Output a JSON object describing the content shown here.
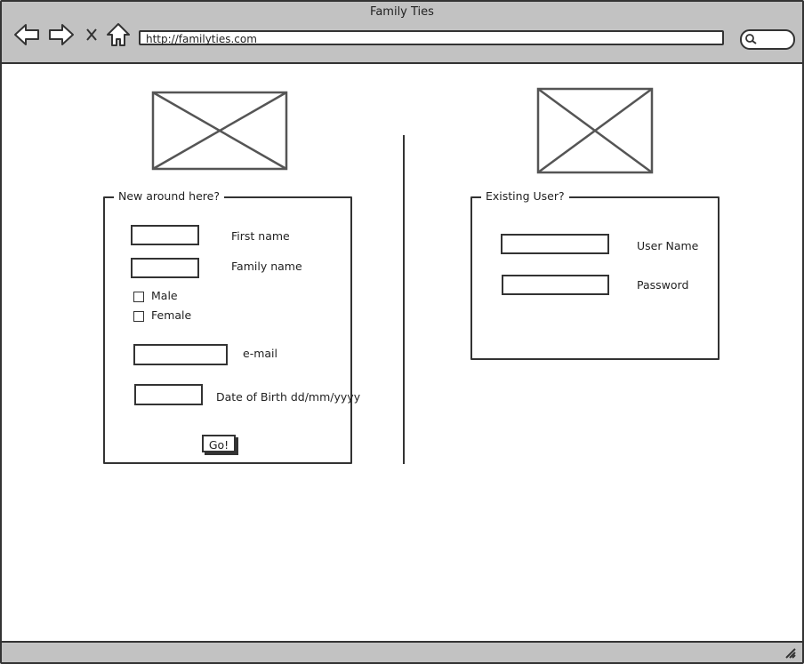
{
  "browser": {
    "title": "Family Ties",
    "url": "http://familyties.com"
  },
  "icons": {
    "back": "back-arrow-icon",
    "forward": "forward-arrow-icon",
    "stop": "close-icon",
    "home": "home-icon",
    "search": "search-icon",
    "resize": "resize-grip-icon",
    "placeholder": "image-placeholder-icon"
  },
  "register": {
    "legend": "New around here?",
    "first_name_label": "First name",
    "family_name_label": "Family name",
    "male_label": "Male",
    "female_label": "Female",
    "email_label": "e-mail",
    "dob_label": "Date of Birth dd/mm/yyyy",
    "submit_label": "Go!"
  },
  "login": {
    "legend": "Existing User?",
    "username_label": "User Name",
    "password_label": "Password"
  }
}
